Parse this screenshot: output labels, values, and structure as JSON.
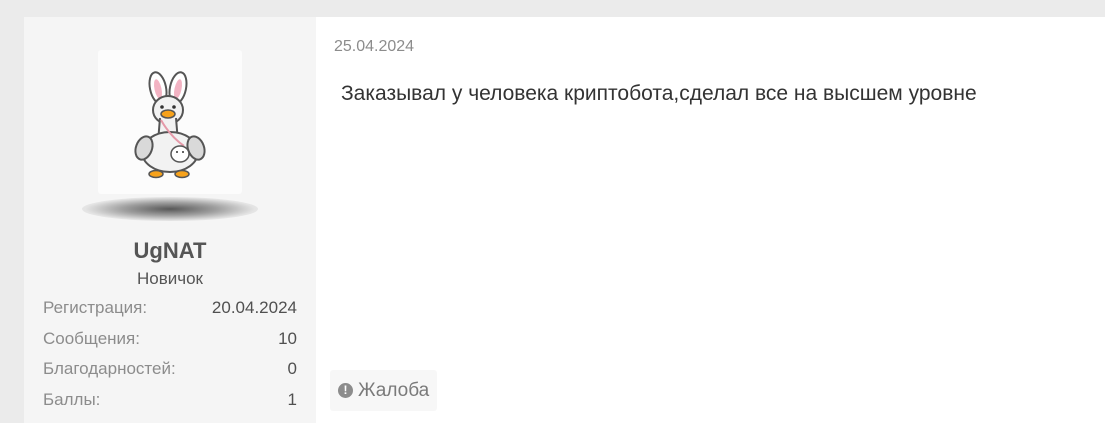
{
  "post": {
    "date": "25.04.2024",
    "message": "Заказывал у человека криптобота,сделал все на высшем уровне",
    "report_label": "Жалоба",
    "report_icon": "alert-circle-icon"
  },
  "user": {
    "avatar": "duck-with-bunny-ears-avatar",
    "name": "UgNAT",
    "title": "Новичок",
    "stats": [
      {
        "label": "Регистрация:",
        "value": "20.04.2024"
      },
      {
        "label": "Сообщения:",
        "value": "10"
      },
      {
        "label": "Благодарностей:",
        "value": "0"
      },
      {
        "label": "Баллы:",
        "value": "1"
      }
    ]
  },
  "colors": {
    "page_background": "#ebebeb",
    "user_panel_background": "#f5f5f5",
    "post_background": "#ffffff",
    "muted_text": "#8c8c8c",
    "body_text": "#333333"
  }
}
